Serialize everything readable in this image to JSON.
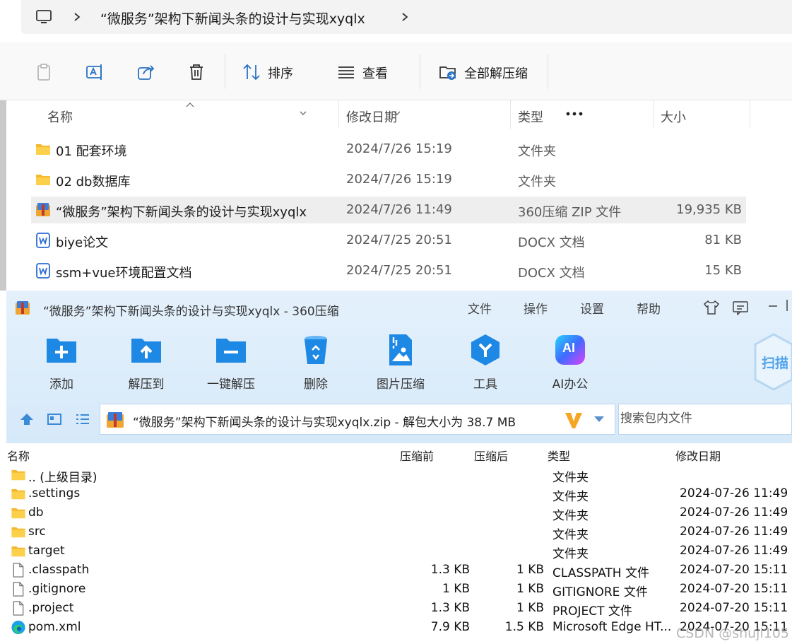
{
  "explorer": {
    "breadcrumb": "“微服务”架构下新闻头条的设计与实现xyqlx",
    "toolbar": {
      "sort_label": "排序",
      "view_label": "查看",
      "extract_all_label": "全部解压缩"
    },
    "columns": {
      "name": "名称",
      "modified": "修改日期",
      "type": "类型",
      "size": "大小"
    },
    "files": [
      {
        "name": "01 配套环境",
        "modified": "2024/7/26 15:19",
        "type": "文件夹",
        "size": "",
        "icon": "folder-icon"
      },
      {
        "name": "02 db数据库",
        "modified": "2024/7/26 15:19",
        "type": "文件夹",
        "size": "",
        "icon": "folder-icon"
      },
      {
        "name": "“微服务”架构下新闻头条的设计与实现xyqlx",
        "modified": "2024/7/26 11:49",
        "type": "360压缩 ZIP 文件",
        "size": "19,935 KB",
        "icon": "zip-archive-icon"
      },
      {
        "name": "biye论文",
        "modified": "2024/7/25 20:51",
        "type": "DOCX 文档",
        "size": "81 KB",
        "icon": "word-doc-icon"
      },
      {
        "name": "ssm+vue环境配置文档",
        "modified": "2024/7/25 20:51",
        "type": "DOCX 文档",
        "size": "15 KB",
        "icon": "word-doc-icon"
      }
    ]
  },
  "zip": {
    "title": "“微服务”架构下新闻头条的设计与实现xyqlx - 360压缩",
    "menu": [
      "文件",
      "操作",
      "设置",
      "帮助"
    ],
    "scan_label": "扫描",
    "toolbar": [
      {
        "label": "添加",
        "icon": "add-folder-icon"
      },
      {
        "label": "解压到",
        "icon": "extract-to-icon"
      },
      {
        "label": "一键解压",
        "icon": "one-click-extract-icon"
      },
      {
        "label": "删除",
        "icon": "recycle-bin-icon"
      },
      {
        "label": "图片压缩",
        "icon": "image-compress-icon"
      },
      {
        "label": "工具",
        "icon": "tools-icon"
      },
      {
        "label": "AI办公",
        "icon": "ai-office-icon"
      }
    ],
    "ai_badge": "AI",
    "path": "“微服务”架构下新闻头条的设计与实现xyqlx.zip - 解包大小为 38.7 MB",
    "search_placeholder": "搜索包内文件",
    "columns": {
      "name": "名称",
      "before": "压缩前",
      "after": "压缩后",
      "type": "类型",
      "modified": "修改日期"
    },
    "entries": [
      {
        "name": ".. (上级目录)",
        "before": "",
        "after": "",
        "type": "文件夹",
        "modified": "",
        "icon": "folder-icon"
      },
      {
        "name": ".settings",
        "before": "",
        "after": "",
        "type": "文件夹",
        "modified": "2024-07-26 11:49",
        "icon": "folder-icon"
      },
      {
        "name": "db",
        "before": "",
        "after": "",
        "type": "文件夹",
        "modified": "2024-07-26 11:49",
        "icon": "folder-icon"
      },
      {
        "name": "src",
        "before": "",
        "after": "",
        "type": "文件夹",
        "modified": "2024-07-26 11:49",
        "icon": "folder-icon"
      },
      {
        "name": "target",
        "before": "",
        "after": "",
        "type": "文件夹",
        "modified": "2024-07-26 11:49",
        "icon": "folder-icon"
      },
      {
        "name": ".classpath",
        "before": "1.3 KB",
        "after": "1 KB",
        "type": "CLASSPATH 文件",
        "modified": "2024-07-20 15:11",
        "icon": "file-icon"
      },
      {
        "name": ".gitignore",
        "before": "1 KB",
        "after": "1 KB",
        "type": "GITIGNORE 文件",
        "modified": "2024-07-20 15:11",
        "icon": "file-icon"
      },
      {
        "name": ".project",
        "before": "1.3 KB",
        "after": "1 KB",
        "type": "PROJECT 文件",
        "modified": "2024-07-20 15:11",
        "icon": "file-icon"
      },
      {
        "name": "pom.xml",
        "before": "7.9 KB",
        "after": "1.5 KB",
        "type": "Microsoft Edge HT...",
        "modified": "2024-07-20 15:11",
        "icon": "edge-icon"
      }
    ]
  },
  "watermark": "CSDN @shuji105",
  "colors": {
    "zip_header_bg": "#dcecfa",
    "zip_icon_blue": "#1e88e5",
    "folder_yellow": "#f8c33c",
    "selection": "#eeeeee"
  }
}
